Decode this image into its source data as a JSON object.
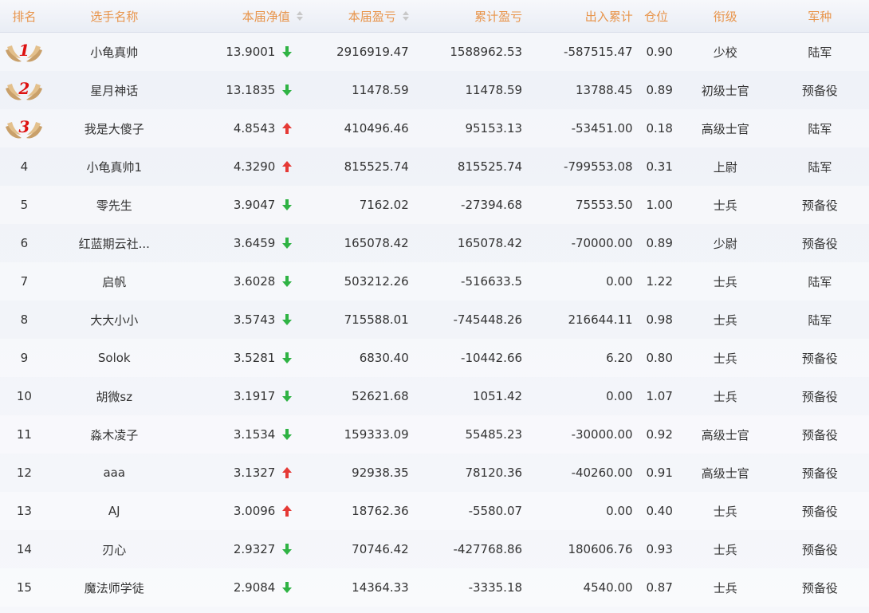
{
  "header": {
    "rank": "排名",
    "name": "选手名称",
    "nav": "本届净值",
    "pl": "本届盈亏",
    "cum": "累计盈亏",
    "flow": "出入累计",
    "pos": "仓位",
    "title": "衔级",
    "branch": "军种"
  },
  "colors": {
    "header_text": "#e8944a",
    "up": "#e53935",
    "down": "#2fb344",
    "medal_num": "#dd1111"
  },
  "rows": [
    {
      "rank": "1",
      "name": "小龟真帅",
      "nav": "13.9001",
      "dir": "down",
      "pl": "2916919.47",
      "cum": "1588962.53",
      "flow": "-587515.47",
      "pos": "0.90",
      "title": "少校",
      "branch": "陆军"
    },
    {
      "rank": "2",
      "name": "星月神话",
      "nav": "13.1835",
      "dir": "down",
      "pl": "11478.59",
      "cum": "11478.59",
      "flow": "13788.45",
      "pos": "0.89",
      "title": "初级士官",
      "branch": "预备役"
    },
    {
      "rank": "3",
      "name": "我是大傻子",
      "nav": "4.8543",
      "dir": "up",
      "pl": "410496.46",
      "cum": "95153.13",
      "flow": "-53451.00",
      "pos": "0.18",
      "title": "高级士官",
      "branch": "陆军"
    },
    {
      "rank": "4",
      "name": "小龟真帅1",
      "nav": "4.3290",
      "dir": "up",
      "pl": "815525.74",
      "cum": "815525.74",
      "flow": "-799553.08",
      "pos": "0.31",
      "title": "上尉",
      "branch": "陆军"
    },
    {
      "rank": "5",
      "name": "零先生",
      "nav": "3.9047",
      "dir": "down",
      "pl": "7162.02",
      "cum": "-27394.68",
      "flow": "75553.50",
      "pos": "1.00",
      "title": "士兵",
      "branch": "预备役"
    },
    {
      "rank": "6",
      "name": "红蓝期云社...",
      "nav": "3.6459",
      "dir": "down",
      "pl": "165078.42",
      "cum": "165078.42",
      "flow": "-70000.00",
      "pos": "0.89",
      "title": "少尉",
      "branch": "预备役"
    },
    {
      "rank": "7",
      "name": "启帆",
      "nav": "3.6028",
      "dir": "down",
      "pl": "503212.26",
      "cum": "-516633.5",
      "flow": "0.00",
      "pos": "1.22",
      "title": "士兵",
      "branch": "陆军"
    },
    {
      "rank": "8",
      "name": "大大小小",
      "nav": "3.5743",
      "dir": "down",
      "pl": "715588.01",
      "cum": "-745448.26",
      "flow": "216644.11",
      "pos": "0.98",
      "title": "士兵",
      "branch": "陆军"
    },
    {
      "rank": "9",
      "name": "Solok",
      "nav": "3.5281",
      "dir": "down",
      "pl": "6830.40",
      "cum": "-10442.66",
      "flow": "6.20",
      "pos": "0.80",
      "title": "士兵",
      "branch": "预备役"
    },
    {
      "rank": "10",
      "name": "胡微sz",
      "nav": "3.1917",
      "dir": "down",
      "pl": "52621.68",
      "cum": "1051.42",
      "flow": "0.00",
      "pos": "1.07",
      "title": "士兵",
      "branch": "预备役"
    },
    {
      "rank": "11",
      "name": "淼木凌子",
      "nav": "3.1534",
      "dir": "down",
      "pl": "159333.09",
      "cum": "55485.23",
      "flow": "-30000.00",
      "pos": "0.92",
      "title": "高级士官",
      "branch": "预备役"
    },
    {
      "rank": "12",
      "name": "aaa",
      "nav": "3.1327",
      "dir": "up",
      "pl": "92938.35",
      "cum": "78120.36",
      "flow": "-40260.00",
      "pos": "0.91",
      "title": "高级士官",
      "branch": "预备役"
    },
    {
      "rank": "13",
      "name": "AJ",
      "nav": "3.0096",
      "dir": "up",
      "pl": "18762.36",
      "cum": "-5580.07",
      "flow": "0.00",
      "pos": "0.40",
      "title": "士兵",
      "branch": "预备役"
    },
    {
      "rank": "14",
      "name": "刃心",
      "nav": "2.9327",
      "dir": "down",
      "pl": "70746.42",
      "cum": "-427768.86",
      "flow": "180606.76",
      "pos": "0.93",
      "title": "士兵",
      "branch": "预备役"
    },
    {
      "rank": "15",
      "name": "魔法师学徒",
      "nav": "2.9084",
      "dir": "down",
      "pl": "14364.33",
      "cum": "-3335.18",
      "flow": "4540.00",
      "pos": "0.87",
      "title": "士兵",
      "branch": "预备役"
    }
  ]
}
